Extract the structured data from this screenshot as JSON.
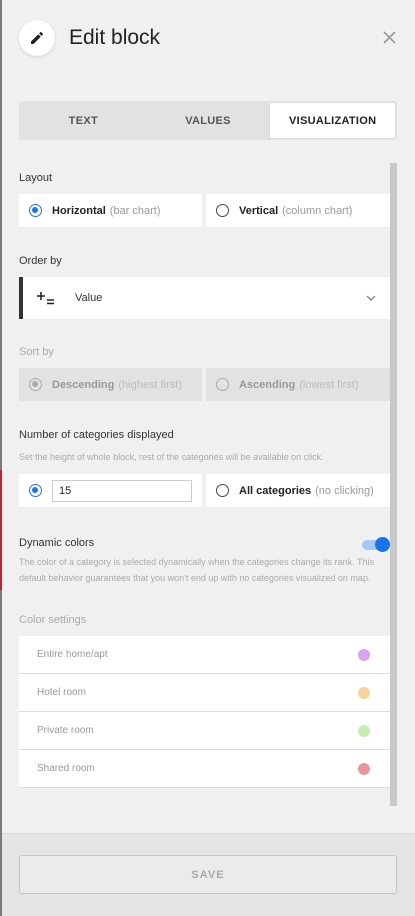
{
  "header": {
    "title": "Edit block",
    "icon": "pencil-icon",
    "close_icon": "close-icon"
  },
  "tabs": [
    {
      "label": "TEXT",
      "active": false
    },
    {
      "label": "VALUES",
      "active": false
    },
    {
      "label": "VISUALIZATION",
      "active": true
    }
  ],
  "layout": {
    "label": "Layout",
    "options": [
      {
        "label": "Horizontal",
        "sub": "(bar chart)",
        "selected": true
      },
      {
        "label": "Vertical",
        "sub": "(column chart)",
        "selected": false
      }
    ]
  },
  "order_by": {
    "label": "Order by",
    "value": "Value",
    "icon": "sort-icon"
  },
  "sort_by": {
    "label": "Sort by",
    "options": [
      {
        "label": "Descending",
        "sub": "(highest first)",
        "selected": true
      },
      {
        "label": "Ascending",
        "sub": "(lowest first)",
        "selected": false
      }
    ]
  },
  "categories": {
    "label": "Number of categories displayed",
    "hint": "Set the height of whole block, rest of the categories will be available on click.",
    "count_value": "15",
    "all_label": "All categories",
    "all_sub": "(no clicking)"
  },
  "dynamic_colors": {
    "label": "Dynamic colors",
    "hint": "The color of a category is selected dynamically when the categories change its rank. This default behavior guarantees that you won't end up with no categories visualized on map.",
    "enabled": true
  },
  "color_settings": {
    "label": "Color settings",
    "items": [
      {
        "name": "Entire home/apt",
        "color": "#d9a3f0"
      },
      {
        "name": "Hotel room",
        "color": "#f5d49c"
      },
      {
        "name": "Private room",
        "color": "#c6ecb4"
      },
      {
        "name": "Shared room",
        "color": "#e8959c"
      }
    ]
  },
  "footer": {
    "save_label": "SAVE"
  }
}
